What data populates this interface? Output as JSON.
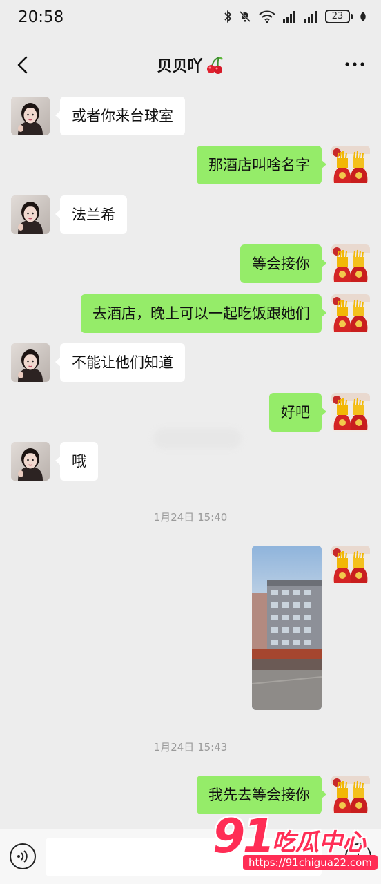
{
  "status_bar": {
    "time": "20:58",
    "battery_level": "23",
    "icons": [
      "bluetooth-icon",
      "mute-bell-icon",
      "wifi-icon",
      "signal-icon",
      "signal-icon",
      "battery-icon",
      "leaf-icon"
    ]
  },
  "header": {
    "title": "贝贝吖",
    "title_emoji": "cherry-icon",
    "back_icon": "chevron-left-icon",
    "more_icon": "more-dots-icon"
  },
  "messages": [
    {
      "side": "left",
      "text": "或者你来台球室"
    },
    {
      "side": "right",
      "text": "那酒店叫啥名字"
    },
    {
      "side": "left",
      "text": "法兰希"
    },
    {
      "side": "right",
      "text": "等会接你"
    },
    {
      "side": "right",
      "text": "去酒店，晚上可以一起吃饭跟她们"
    },
    {
      "side": "left",
      "text": "不能让他们知道"
    },
    {
      "side": "right",
      "text": "好吧"
    },
    {
      "side": "left",
      "text": "哦"
    },
    {
      "type": "timestamp",
      "text": "1月24日 15:40"
    },
    {
      "side": "right",
      "type": "image",
      "image": "building-photo"
    },
    {
      "type": "timestamp",
      "text": "1月24日 15:43"
    },
    {
      "side": "right",
      "text": "我先去等会接你"
    }
  ],
  "input_bar": {
    "voice_icon": "voice-icon",
    "input_value": "",
    "plus_icon": "plus-icon"
  },
  "watermark": {
    "logo": "91",
    "title": "吃瓜中心",
    "url": "https://91chigua22.com"
  },
  "colors": {
    "background": "#ededed",
    "self_bubble": "#95ec69",
    "other_bubble": "#ffffff",
    "watermark": "#ff2d55"
  }
}
